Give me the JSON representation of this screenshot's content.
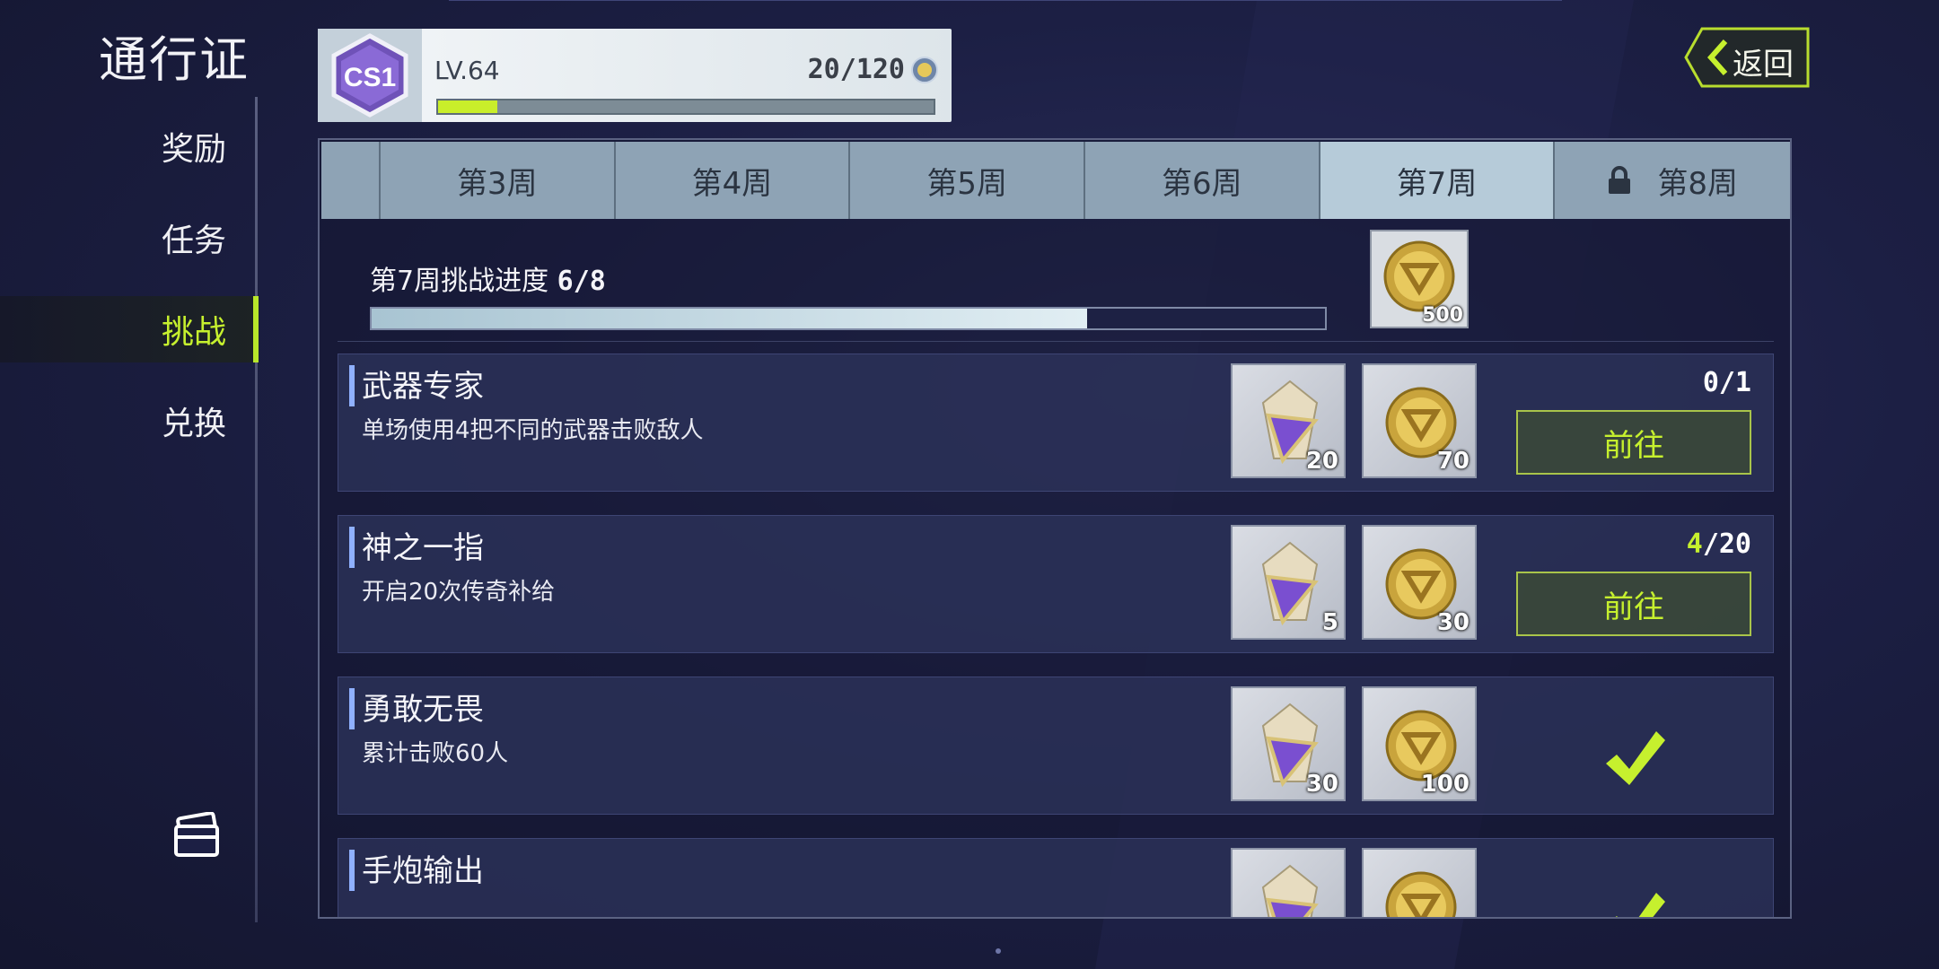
{
  "nav": {
    "title": "通行证",
    "items": [
      {
        "label": "奖励",
        "active": false
      },
      {
        "label": "任务",
        "active": false
      },
      {
        "label": "挑战",
        "active": true
      },
      {
        "label": "兑换",
        "active": false
      }
    ],
    "album_icon": "cards-album-icon"
  },
  "level": {
    "badge": "CS1",
    "lv": "LV.64",
    "exp": "20/120",
    "exp_progress": 0.12,
    "exp_icon": "pass-coin-icon"
  },
  "back_button": "返回",
  "tabs": [
    {
      "label": "第3周",
      "active": false,
      "locked": false
    },
    {
      "label": "第4周",
      "active": false,
      "locked": false
    },
    {
      "label": "第5周",
      "active": false,
      "locked": false
    },
    {
      "label": "第6周",
      "active": false,
      "locked": false
    },
    {
      "label": "第7周",
      "active": true,
      "locked": false
    },
    {
      "label": "第8周",
      "active": false,
      "locked": true
    }
  ],
  "week_progress": {
    "label": "第7周挑战进度",
    "value": "6/8",
    "fraction": 0.75,
    "reward_amount": "500"
  },
  "tasks": [
    {
      "title": "武器专家",
      "desc": "单场使用4把不同的武器击败敌人",
      "reward_a": "20",
      "reward_b": "70",
      "count_cur": "0",
      "count_total": "/1",
      "action": "前往",
      "done": false
    },
    {
      "title": "神之一指",
      "desc": "开启20次传奇补给",
      "reward_a": "5",
      "reward_b": "30",
      "count_cur": "4",
      "count_total": "/20",
      "action": "前往",
      "done": false
    },
    {
      "title": "勇敢无畏",
      "desc": "累计击败60人",
      "reward_a": "30",
      "reward_b": "100",
      "count_cur": "",
      "count_total": "",
      "action": "",
      "done": true
    },
    {
      "title": "手炮输出",
      "desc": "",
      "reward_a": "",
      "reward_b": "",
      "count_cur": "",
      "count_total": "",
      "action": "",
      "done": true
    }
  ],
  "colors": {
    "accent": "#c6f02e",
    "panel": "#2e345c",
    "tab": "#8ea3b5",
    "tab_active": "#b6cbd9"
  }
}
